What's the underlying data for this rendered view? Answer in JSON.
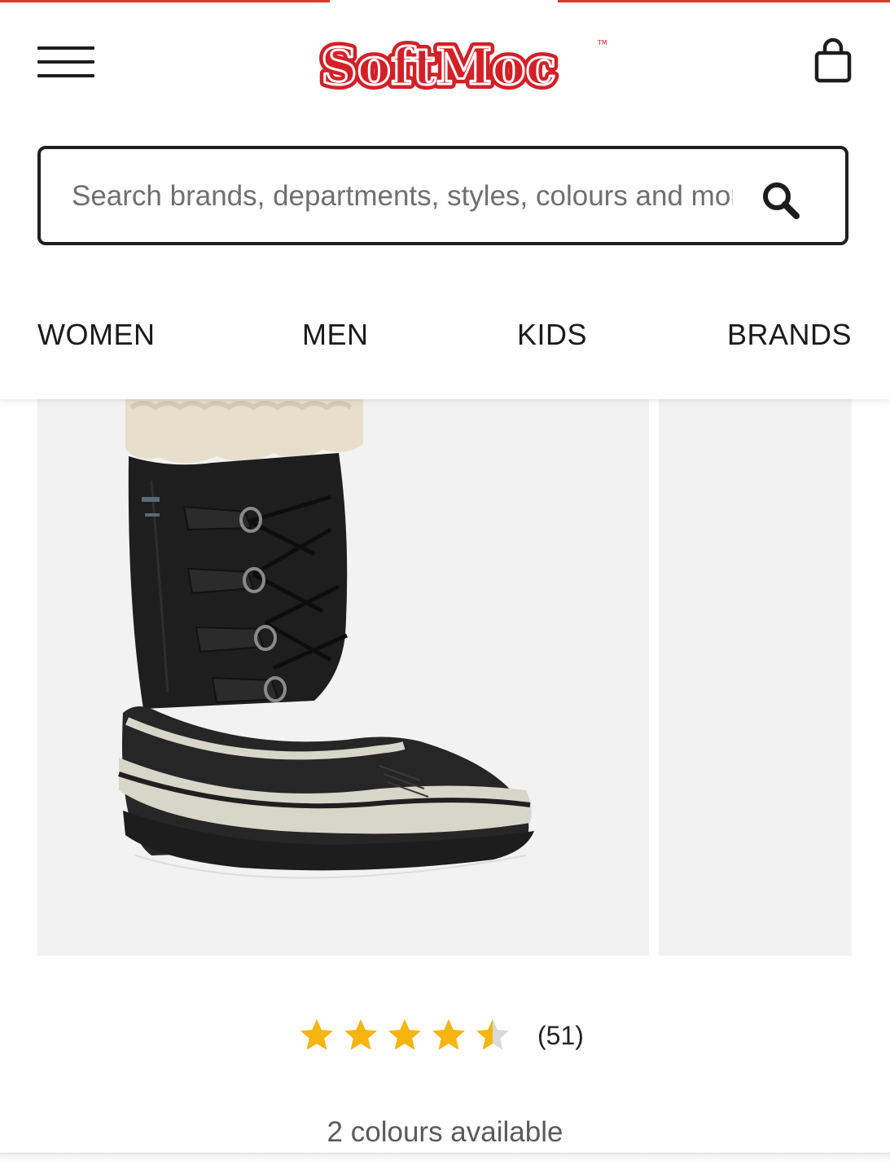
{
  "brand": {
    "logo_text": "SoftMoc",
    "trademark": "TM",
    "accent_color": "#d32027"
  },
  "header": {
    "menu_icon": "hamburger-menu-icon",
    "bag_icon": "shopping-bag-icon"
  },
  "search": {
    "placeholder": "Search brands, departments, styles, colours and more",
    "icon": "search-icon"
  },
  "nav": {
    "items": [
      {
        "label": "WOMEN"
      },
      {
        "label": "MEN"
      },
      {
        "label": "KIDS"
      },
      {
        "label": "BRANDS"
      }
    ]
  },
  "product": {
    "image_description": "black winter boot with fleece cuff",
    "rating": 4.5,
    "rating_max": 5,
    "review_count": "(51)",
    "colours_text": "2 colours available",
    "star_color": "#f6b40e"
  }
}
